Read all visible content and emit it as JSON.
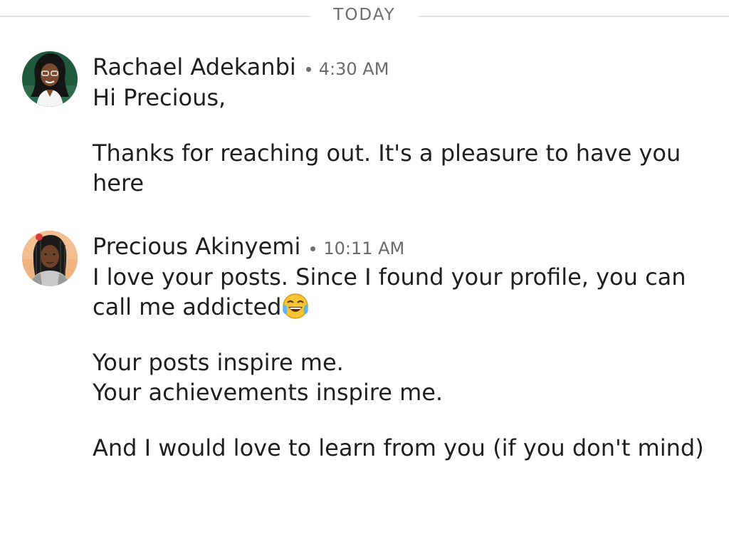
{
  "divider": {
    "label": "TODAY"
  },
  "messages": [
    {
      "sender": "Rachael Adekanbi",
      "time": "4:30 AM",
      "avatar_icon": "profile-photo-rachael",
      "paragraphs": [
        "Hi Precious,",
        "Thanks for reaching out. It's a pleasure to have you here"
      ]
    },
    {
      "sender": "Precious Akinyemi",
      "time": "10:11 AM",
      "avatar_icon": "profile-photo-precious",
      "paragraphs": [
        "I love your posts. Since I found your profile, you can call me addicted",
        "Your posts inspire me.\nYour achievements inspire me.",
        "And I would love to learn from you (if you don't mind)"
      ],
      "emoji_icon": "face-with-tears-of-joy-emoji"
    }
  ]
}
